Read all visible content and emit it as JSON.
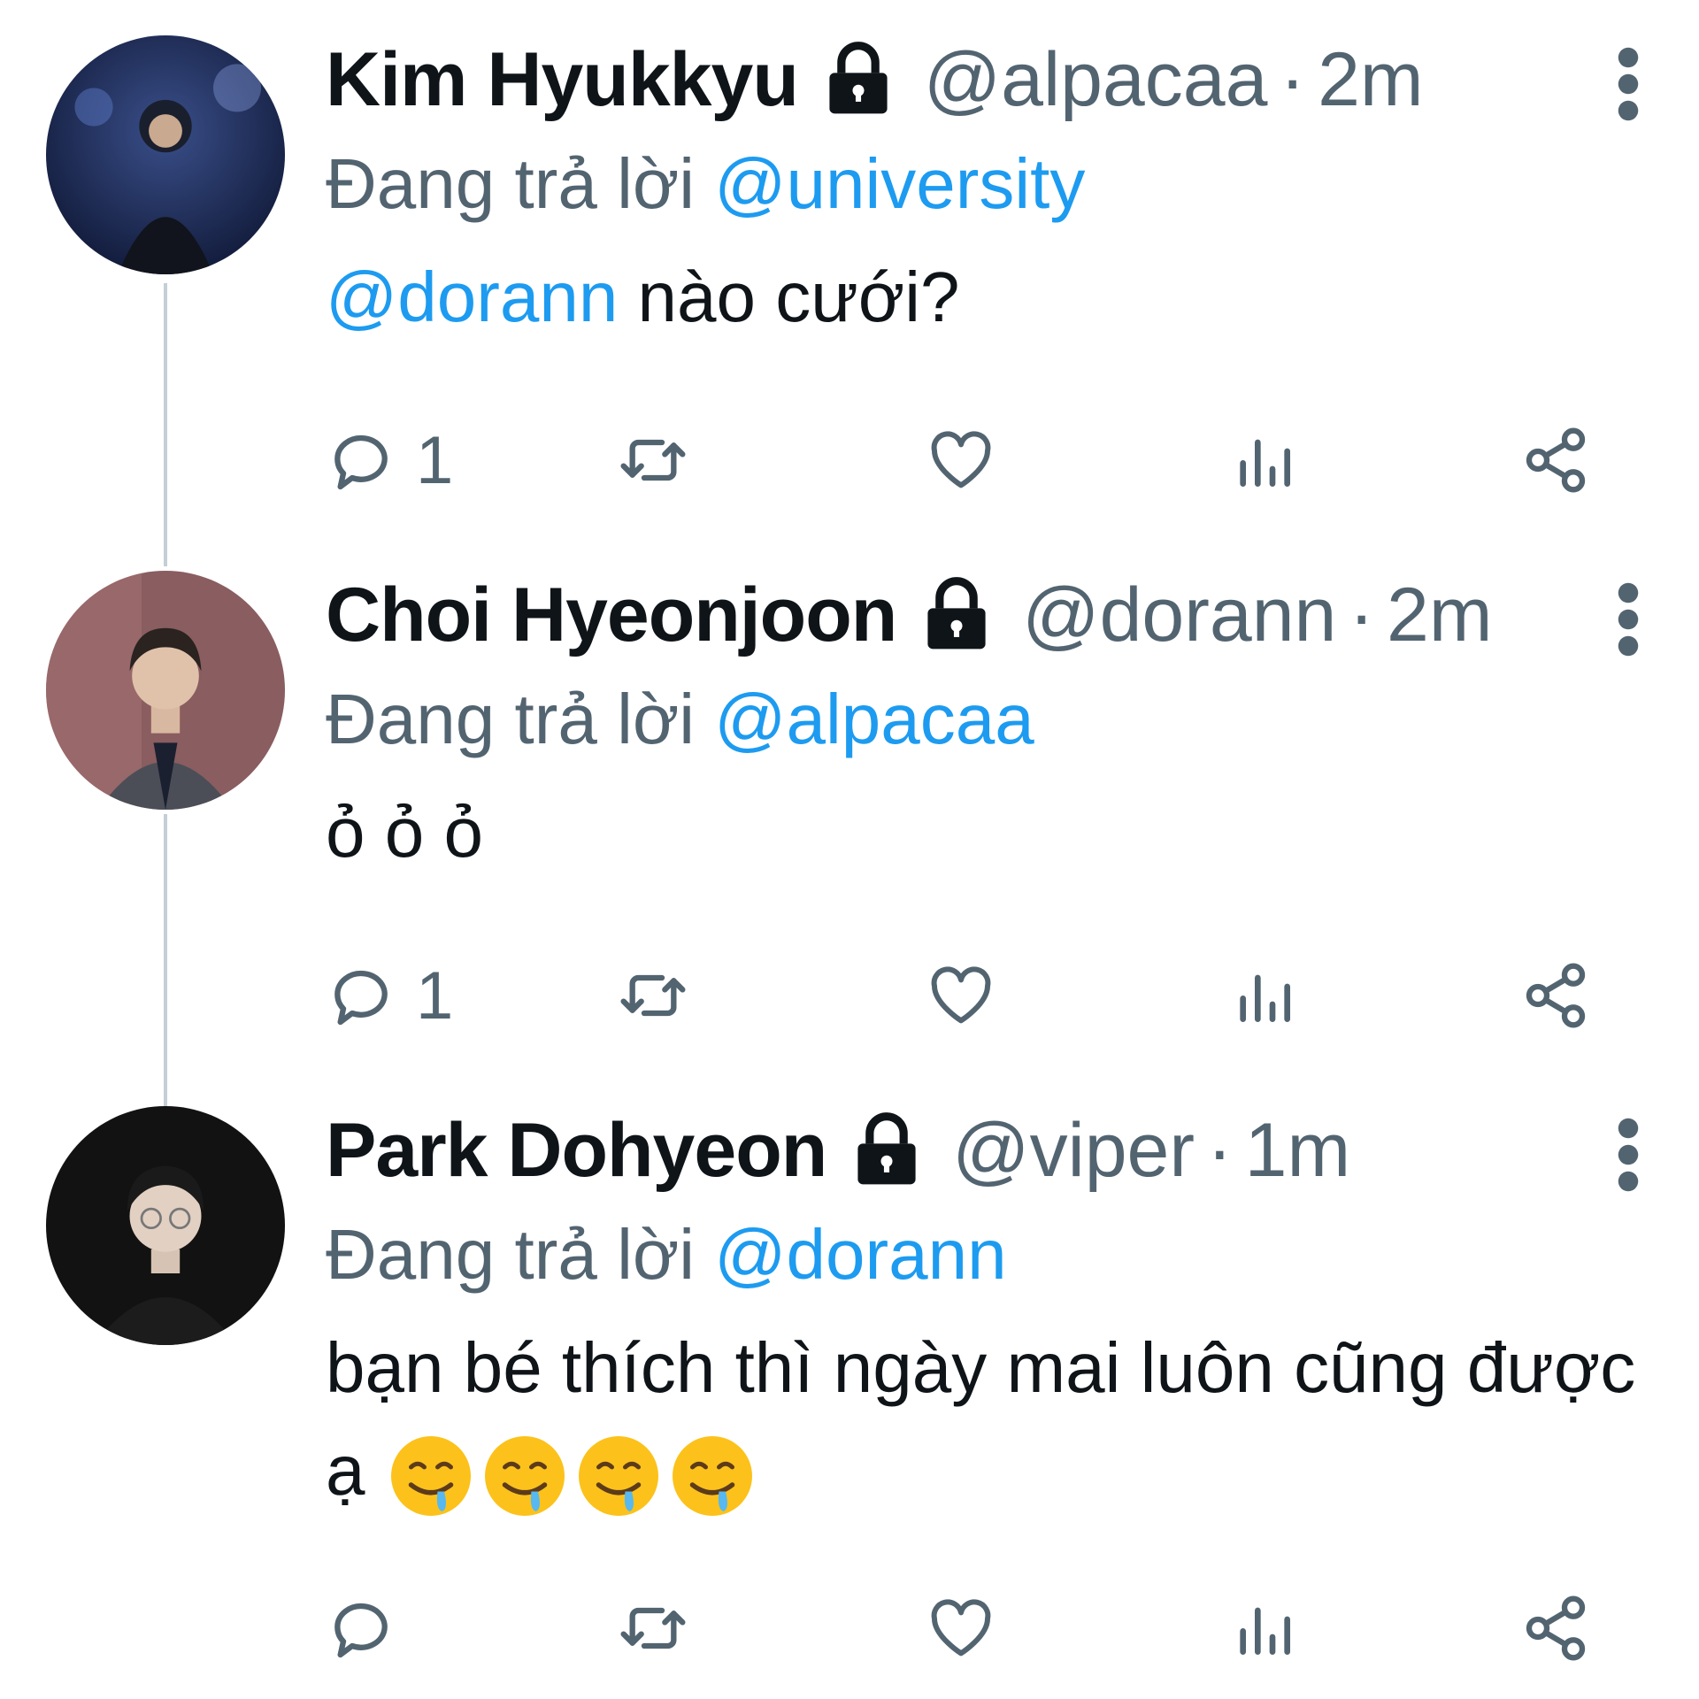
{
  "tweets": [
    {
      "name": "Kim Hyukkyu",
      "handle": "@alpacaa",
      "time": "2m",
      "replying_prefix": "Đang trả lời ",
      "replying_to": "@university",
      "body_mention": "@dorann",
      "body_text": " nào cưới?",
      "reply_count": "1"
    },
    {
      "name": "Choi Hyeonjoon",
      "handle": "@dorann",
      "time": "2m",
      "replying_prefix": "Đang trả lời ",
      "replying_to": "@alpacaa",
      "body_mention": "",
      "body_text": "ỏ ỏ ỏ",
      "reply_count": "1"
    },
    {
      "name": "Park Dohyeon",
      "handle": "@viper",
      "time": "1m",
      "replying_prefix": "Đang trả lời ",
      "replying_to": "@dorann",
      "body_mention": "",
      "body_text": "bạn bé thích thì ngày mai luôn cũng được ạ",
      "emojis": [
        "drooling-face-emoji",
        "drooling-face-emoji",
        "drooling-face-emoji",
        "drooling-face-emoji"
      ],
      "reply_count": ""
    }
  ],
  "separator": "·",
  "colors": {
    "text": "#0f1419",
    "secondary": "#536471",
    "link": "#1d9bf0",
    "connector": "#c4cfd6"
  },
  "icons": {
    "verified_lock": "lock-icon",
    "more": "more-vertical-icon",
    "reply": "reply-icon",
    "retweet": "retweet-icon",
    "like": "heart-icon",
    "views": "analytics-icon",
    "share": "share-icon"
  }
}
